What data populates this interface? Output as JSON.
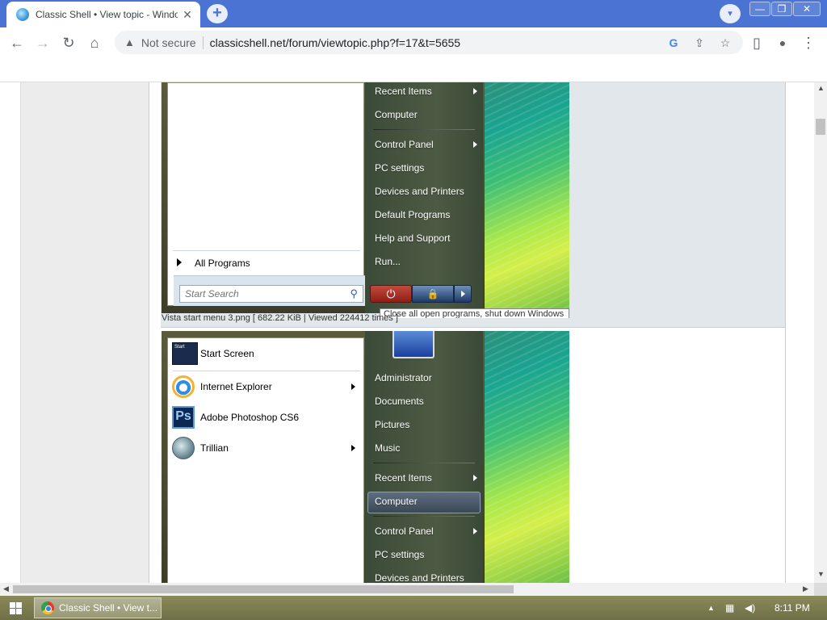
{
  "browser": {
    "tab_title": "Classic Shell • View topic - Windo",
    "new_tab": "+",
    "tab_close": "✕",
    "tab_search": "▾",
    "window_controls": [
      "—",
      "❐",
      "✕"
    ],
    "security_text": "Not secure",
    "url": "classicshell.net/forum/viewtopic.php?f=17&t=5655",
    "nav": {
      "back": "←",
      "forward": "→",
      "reload": "↻",
      "home": "⌂"
    },
    "omnibox_icons": {
      "google": "G",
      "share": "⇪",
      "star": "☆"
    },
    "toolbar_icons": {
      "sidepanel": "▯",
      "profile": "●",
      "menu": "⋮"
    }
  },
  "post1": {
    "start_menu": {
      "right_items": [
        {
          "label": "Recent Items",
          "submenu": true
        },
        {
          "label": "Computer",
          "submenu": false
        },
        {
          "label": "Control Panel",
          "submenu": true
        },
        {
          "label": "PC settings",
          "submenu": false
        },
        {
          "label": "Devices and Printers",
          "submenu": false
        },
        {
          "label": "Default Programs",
          "submenu": false
        },
        {
          "label": "Help and Support",
          "submenu": false
        },
        {
          "label": "Run...",
          "submenu": false
        }
      ],
      "all_programs": "All Programs",
      "search_placeholder": "Start Search",
      "tooltip": "Close all open programs, shut down Windows"
    },
    "attachment_caption": "Vista start menu 3.png [ 682.22 KiB | Viewed 224412 times ]"
  },
  "post2": {
    "start_menu": {
      "left_items": [
        {
          "label": "Start Screen",
          "icon": "start-screen-icon",
          "submenu": false
        },
        {
          "label": "Internet Explorer",
          "icon": "internet-explorer-icon",
          "submenu": true
        },
        {
          "label": "Adobe Photoshop CS6",
          "icon": "photoshop-icon",
          "submenu": false
        },
        {
          "label": "Trillian",
          "icon": "trillian-icon",
          "submenu": true
        }
      ],
      "right_items": [
        {
          "label": "Administrator",
          "submenu": false
        },
        {
          "label": "Documents",
          "submenu": false
        },
        {
          "label": "Pictures",
          "submenu": false
        },
        {
          "label": "Music",
          "submenu": false
        },
        {
          "label": "Recent Items",
          "submenu": true
        },
        {
          "label": "Computer",
          "submenu": false,
          "highlighted": true
        },
        {
          "label": "Control Panel",
          "submenu": true
        },
        {
          "label": "PC settings",
          "submenu": false
        },
        {
          "label": "Devices and Printers",
          "submenu": false
        }
      ],
      "photoshop_icon_text": "Ps",
      "start_icon_text": "Start"
    }
  },
  "taskbar": {
    "item_label": "Classic Shell • View t...",
    "clock": "8:11 PM",
    "tray_icons": [
      "tray-up-arrow-icon",
      "network-icon",
      "volume-icon"
    ]
  },
  "colors": {
    "chrome_frame": "#4b73d3",
    "menu_frame": "#4e4d33",
    "taskbar": "#7e7e52",
    "highlight": "#4a5868"
  }
}
